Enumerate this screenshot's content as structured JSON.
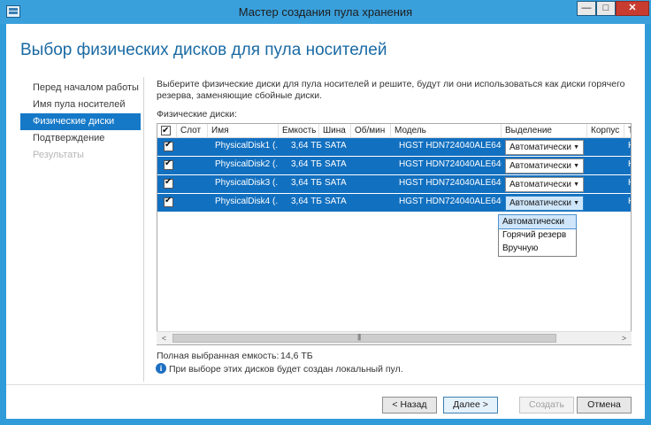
{
  "window": {
    "title": "Мастер создания пула хранения",
    "controls": {
      "minimize": "—",
      "maximize": "□",
      "close": "✕"
    }
  },
  "page": {
    "title": "Выбор физических дисков для пула носителей",
    "description": "Выберите физические диски для пула носителей и решите, будут ли они использоваться как диски горячего резерва, заменяющие сбойные диски.",
    "list_label": "Физические диски:"
  },
  "nav": {
    "items": [
      {
        "label": "Перед началом работы",
        "state": "normal"
      },
      {
        "label": "Имя пула носителей",
        "state": "normal"
      },
      {
        "label": "Физические диски",
        "state": "active"
      },
      {
        "label": "Подтверждение",
        "state": "normal"
      },
      {
        "label": "Результаты",
        "state": "disabled"
      }
    ]
  },
  "grid": {
    "columns": [
      "Слот",
      "Имя",
      "Емкость",
      "Шина",
      "Об/мин",
      "Модель",
      "Выделение",
      "Корпус",
      "Ти"
    ],
    "rows": [
      {
        "checked": true,
        "slot": "",
        "name": "PhysicalDisk1 (...",
        "capacity": "3,64 ТБ",
        "bus": "SATA",
        "rpm": "",
        "model": "HGST HDN724040ALE640",
        "allocation": "Автоматически",
        "enclosure": "",
        "type": "H"
      },
      {
        "checked": true,
        "slot": "",
        "name": "PhysicalDisk2 (...",
        "capacity": "3,64 ТБ",
        "bus": "SATA",
        "rpm": "",
        "model": "HGST HDN724040ALE640",
        "allocation": "Автоматически",
        "enclosure": "",
        "type": "H"
      },
      {
        "checked": true,
        "slot": "",
        "name": "PhysicalDisk3 (...",
        "capacity": "3,64 ТБ",
        "bus": "SATA",
        "rpm": "",
        "model": "HGST HDN724040ALE640",
        "allocation": "Автоматически",
        "enclosure": "",
        "type": "H"
      },
      {
        "checked": true,
        "slot": "",
        "name": "PhysicalDisk4 (...",
        "capacity": "3,64 ТБ",
        "bus": "SATA",
        "rpm": "",
        "model": "HGST HDN724040ALE640",
        "allocation": "Автоматически",
        "enclosure": "",
        "type": "H"
      }
    ],
    "dropdown_options": [
      "Автоматически",
      "Горячий резерв",
      "Вручную"
    ],
    "dropdown_selected": "Автоматически"
  },
  "summary": {
    "capacity_label": "Полная выбранная емкость:",
    "capacity_value": "14,6 ТБ",
    "info_text": "При выборе этих дисков будет создан локальный пул."
  },
  "buttons": {
    "back": "< Назад",
    "next": "Далее >",
    "create": "Создать",
    "cancel": "Отмена"
  }
}
